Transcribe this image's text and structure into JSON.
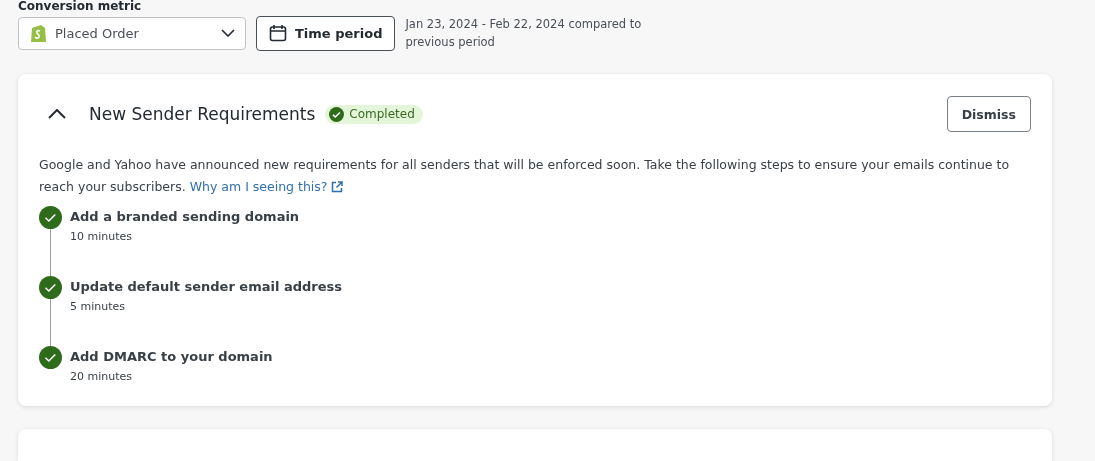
{
  "filters": {
    "label": "Conversion metric",
    "metric": {
      "value": "Placed Order"
    },
    "time_button": "Time period",
    "range_text": "Jan 23, 2024 - Feb 22, 2024 compared to previous period"
  },
  "card": {
    "title": "New Sender Requirements",
    "expanded": true,
    "badge": "Completed",
    "dismiss": "Dismiss",
    "description": "Google and Yahoo have announced new requirements for all senders that will be enforced soon. Take the following steps to ensure your emails continue to reach your subscribers.",
    "link": "Why am I seeing this?",
    "steps": [
      {
        "title": "Add a branded sending domain",
        "duration": "10 minutes",
        "done": true
      },
      {
        "title": "Update default sender email address",
        "duration": "5 minutes",
        "done": true
      },
      {
        "title": "Add DMARC to your domain",
        "duration": "20 minutes",
        "done": true
      }
    ]
  }
}
